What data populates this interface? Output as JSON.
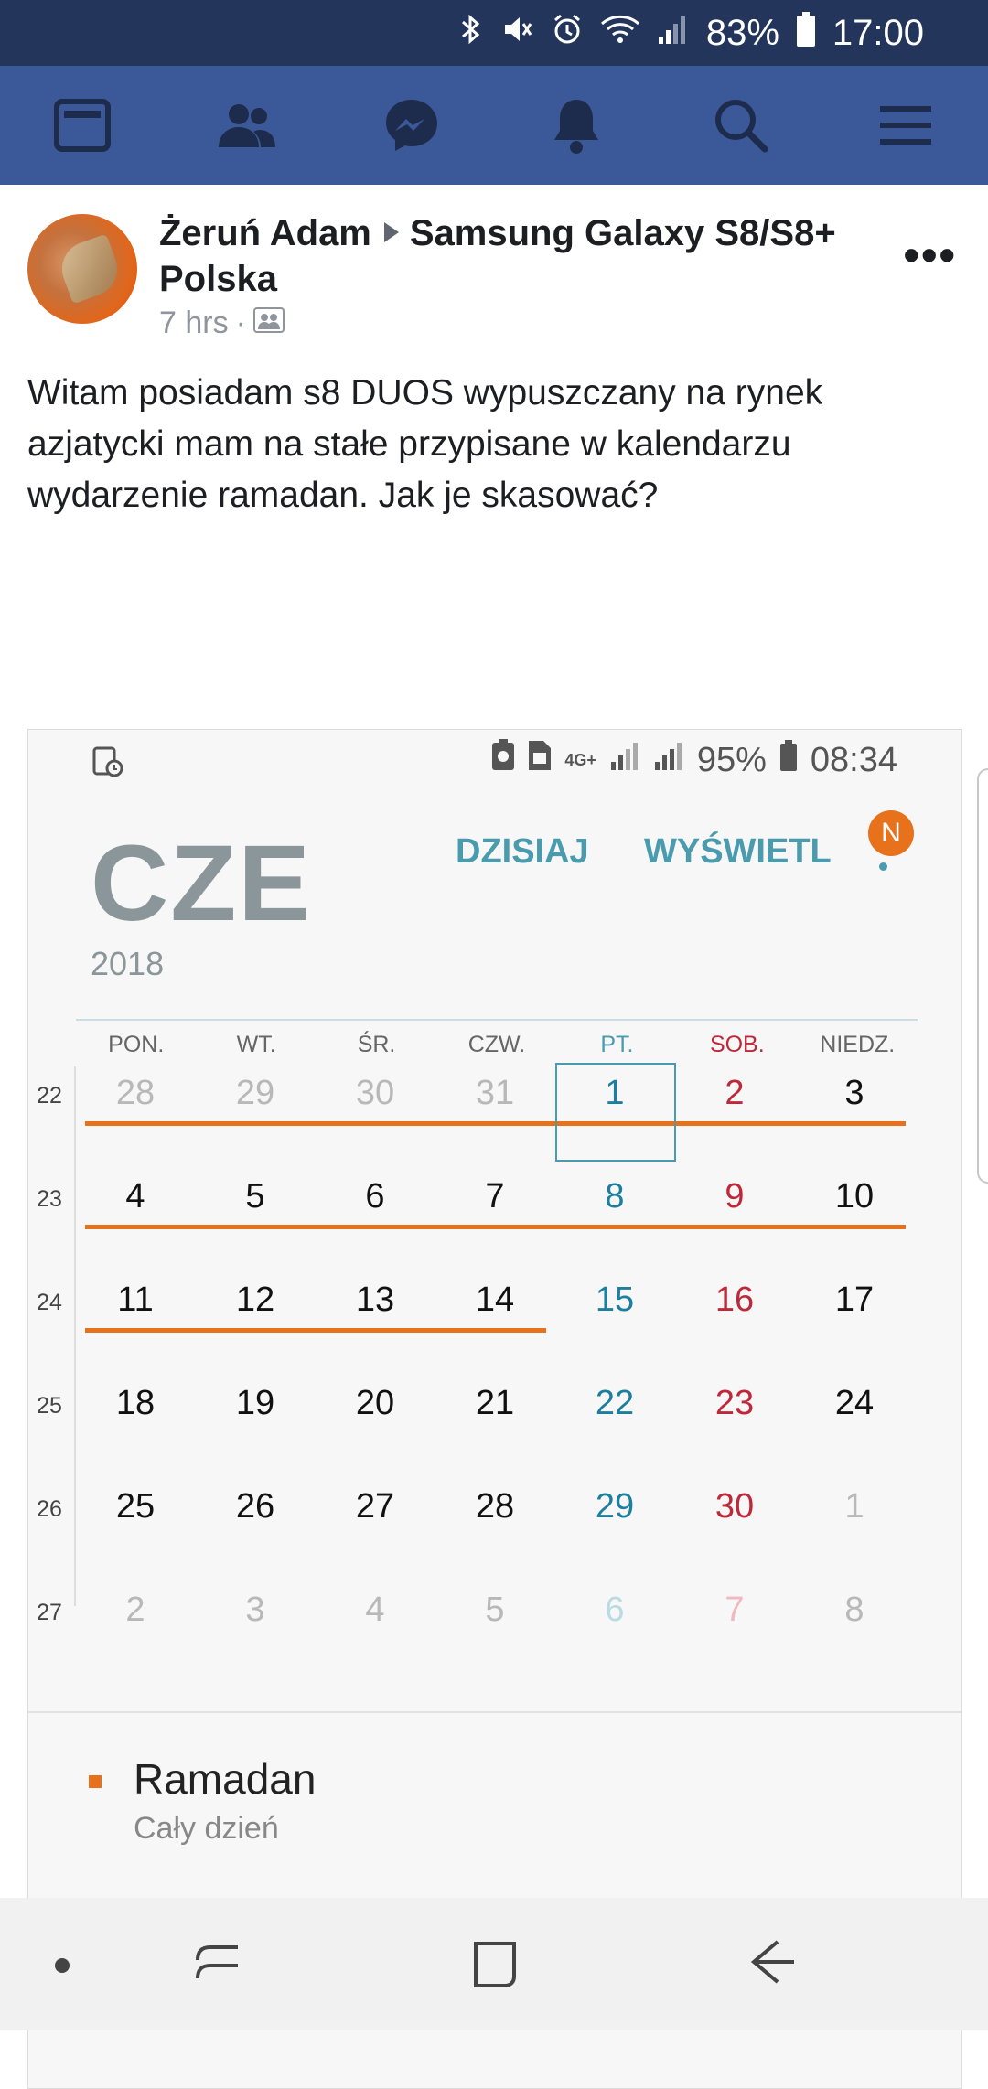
{
  "statusbar": {
    "battery": "83%",
    "time": "17:00"
  },
  "nav": {
    "icons": [
      "news-feed-icon",
      "friends-icon",
      "messenger-icon",
      "notifications-icon",
      "search-icon",
      "menu-icon"
    ]
  },
  "post": {
    "author": "Żeruń Adam",
    "group": "Samsung Galaxy S8/S8+ Polska",
    "time": "7 hrs",
    "separator": "·",
    "more": "•••",
    "text": "Witam posiadam s8 DUOS wypuszczany na rynek azjatycki mam na stałe przypisane w kalendarzu wydarzenie ramadan. Jak je skasować?"
  },
  "screenshot": {
    "status": {
      "network": "4G+",
      "battery": "95%",
      "time": "08:34"
    },
    "month": "CZE",
    "year": "2018",
    "today_label": "DZISIAJ",
    "view_label": "WYŚWIETL",
    "badge": "N",
    "weekdays": [
      "PON.",
      "WT.",
      "ŚR.",
      "CZW.",
      "PT.",
      "SOB.",
      "NIEDZ."
    ],
    "weeks": [
      {
        "num": "22",
        "days": [
          "28",
          "29",
          "30",
          "31",
          "1",
          "2",
          "3"
        ]
      },
      {
        "num": "23",
        "days": [
          "4",
          "5",
          "6",
          "7",
          "8",
          "9",
          "10"
        ]
      },
      {
        "num": "24",
        "days": [
          "11",
          "12",
          "13",
          "14",
          "15",
          "16",
          "17"
        ]
      },
      {
        "num": "25",
        "days": [
          "18",
          "19",
          "20",
          "21",
          "22",
          "23",
          "24"
        ]
      },
      {
        "num": "26",
        "days": [
          "25",
          "26",
          "27",
          "28",
          "29",
          "30",
          "1"
        ]
      },
      {
        "num": "27",
        "days": [
          "2",
          "3",
          "4",
          "5",
          "6",
          "7",
          "8"
        ]
      }
    ],
    "event": {
      "title": "Ramadan",
      "subtitle": "Cały dzień"
    }
  },
  "colors": {
    "facebook_blue": "#3b5998",
    "status_bar": "#23355b",
    "accent_teal": "#4a9bad",
    "event_orange": "#e8711b",
    "sunday_red": "#c0283a"
  }
}
